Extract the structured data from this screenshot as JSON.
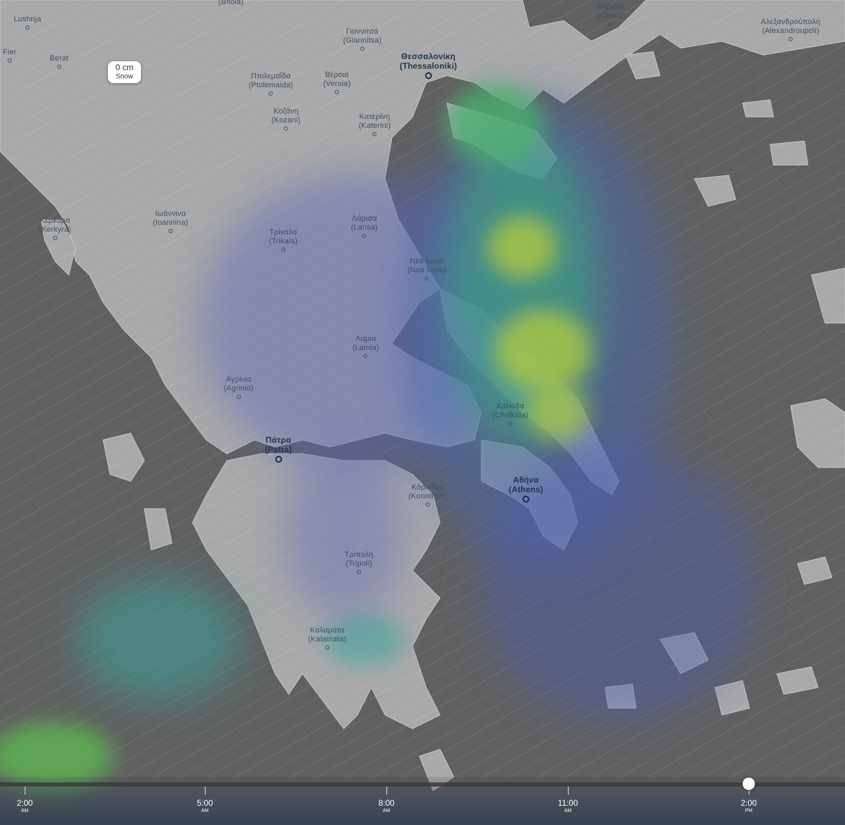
{
  "tooltip": {
    "value": "0 cm",
    "layer": "Snow"
  },
  "cities": [
    {
      "id": "bitola",
      "name": "(Bitola)",
      "major": false
    },
    {
      "id": "kavala",
      "name": "Καβάλα\n(Kavala)",
      "major": false
    },
    {
      "id": "alexandroupoli",
      "name": "Αλεξανδρούπολη\n(Alexandroupoli)",
      "major": false
    },
    {
      "id": "lushnja",
      "name": "Lushnja",
      "major": false
    },
    {
      "id": "fier",
      "name": "Fier",
      "major": false
    },
    {
      "id": "berat",
      "name": "Berat",
      "major": false
    },
    {
      "id": "giannitsa",
      "name": "Γιαννιτσά\n(Giannitsa)",
      "major": false
    },
    {
      "id": "thessaloniki",
      "name": "Θεσσαλονίκη\n(Thessaloniki)",
      "major": true
    },
    {
      "id": "ptolemaida",
      "name": "Πτολεμαΐδα\n(Ptolemaida)",
      "major": false
    },
    {
      "id": "veroia",
      "name": "Βέροια\n(Veroia)",
      "major": false
    },
    {
      "id": "kozani",
      "name": "Κοζάνη\n(Kozani)",
      "major": false
    },
    {
      "id": "katerini",
      "name": "Κατερίνη\n(Katerini)",
      "major": false
    },
    {
      "id": "kerkyra",
      "name": "Κέρκυρα\n(Kerkyra)",
      "major": false
    },
    {
      "id": "ioannina",
      "name": "Ιωάννινα\n(Ioannina)",
      "major": false
    },
    {
      "id": "trikala",
      "name": "Τρίκαλα\n(Trikala)",
      "major": false
    },
    {
      "id": "larisa",
      "name": "Λάρισα\n(Larisa)",
      "major": false
    },
    {
      "id": "nea_ionia",
      "name": "Νέα Ιωνία\n(Nea Ionia)",
      "major": false
    },
    {
      "id": "lamia",
      "name": "Λαμία\n(Lamia)",
      "major": false
    },
    {
      "id": "agrinio",
      "name": "Αγρίνιο\n(Agrinio)",
      "major": false
    },
    {
      "id": "chalkida",
      "name": "Χαλκίδα\n(Chalkida)",
      "major": false
    },
    {
      "id": "patra",
      "name": "Πάτρα\n(Patra)",
      "major": true
    },
    {
      "id": "athens",
      "name": "Αθήνα\n(Athens)",
      "major": true
    },
    {
      "id": "korinthos",
      "name": "Κόρινθος\n(Korinthos)",
      "major": false
    },
    {
      "id": "tripoli",
      "name": "Τρίπολη\n(Tripoli)",
      "major": false
    },
    {
      "id": "kalamata",
      "name": "Καλαμάτα\n(Kalamata)",
      "major": false
    }
  ],
  "timeline": {
    "ticks": [
      {
        "time": "2:00",
        "ampm": "AM"
      },
      {
        "time": "5:00",
        "ampm": "AM"
      },
      {
        "time": "8:00",
        "ampm": "AM"
      },
      {
        "time": "11:00",
        "ampm": "AM"
      },
      {
        "time": "2:00",
        "ampm": "PM"
      }
    ]
  }
}
